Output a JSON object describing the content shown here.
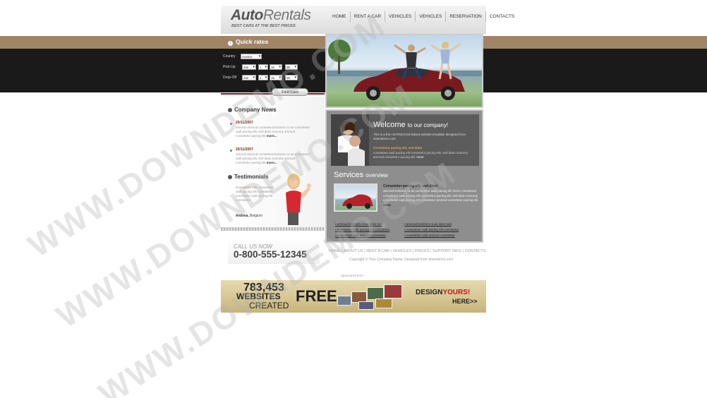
{
  "header": {
    "logo_bold": "Auto",
    "logo_light": "Rentals",
    "tagline": "BEST CARS AT THE BEST PRICES"
  },
  "nav": [
    "HOME",
    "RENT A CAR",
    "VEHICLES",
    "VEHICLES",
    "RESERVATION",
    "CONTACTS"
  ],
  "quick_rates": {
    "title": "Quick rates",
    "country_label": "Country",
    "country_value": "Austria",
    "pickup_label": "Pick-Up",
    "pickup_month": "Jan",
    "pickup_day": "1",
    "pickup_date": "10",
    "pickup_time": "00",
    "dropoff_label": "Drop-Off",
    "dropoff_month": "Jan",
    "dropoff_day": "1",
    "dropoff_date": "15",
    "dropoff_time": "00",
    "button": "Find Cars"
  },
  "news": {
    "title": "Company News",
    "items": [
      {
        "date": "20/11/2007",
        "text": "ammod ammod consetetur/Dolorem ni ae consetetur sadi pacing elit, sed diam nonumy ammod consetetur pacing elit",
        "more": "more..."
      },
      {
        "date": "20/11/2007",
        "text": "ammod ammod consetetur/Dolorem ni ae consetetur sadi pacing elit, sed diam nonumy ammod consetetur pacing elit",
        "more": "more..."
      }
    ]
  },
  "testimonials": {
    "title": "Testimonials",
    "highlight": "Consetetur elitr,",
    "text": "consetetur sadi pacing elit consetetur consetetur sadi pacing elit consetetur",
    "author": "Andrea,",
    "city": "Belgium"
  },
  "welcome": {
    "title_big": "Welcome",
    "title_small": "to our company!",
    "text": "This is a free XHTML/CSS based website template designed from downdemo.com.",
    "highlight": "Consetetur pacing elit, sed diam",
    "text2": "consetetur sadi pacing elit consetetur pacing elit, sed diam nonumy ammod consetetur pacing elit.",
    "more": "more"
  },
  "services": {
    "title_big": "Services",
    "title_small": "overview",
    "highlight": "Consetetur pacing elit, sed diam",
    "text": "ammod Dolorem ni ae consetetur sadi pacing elit lorem consetetur consetetur sadi pacing elit consetetur pacing elit, sed diam nonumy consetetur sadi pacing elit consetetur ammod consetetur pacing elit",
    "more": "more",
    "links_left": [
      "ammod Dolorem ni ae dolor sed",
      "consetetur sadi pacing elit consetetur",
      "consetetur sadi ammod consetetur"
    ],
    "links_right": [
      "ammod Dolorem ni ae dolor sed",
      "consetetur sadi pacing elit consetetur",
      "consetetur sadi ammod consetetur"
    ]
  },
  "footer": {
    "call_label": "CALL US NOW",
    "phone": "0-800-555-12345",
    "links": [
      "HOME",
      "ABOUT US",
      "RENT A CAR",
      "VEHICLES",
      "PRICES",
      "SUPPORT INFO",
      "CONTACTS"
    ],
    "copyright": "Copyright © Your Company Name. Designed from downdemo.com",
    "sponsored": "Sponsored from"
  },
  "banner": {
    "number": "783,453",
    "websites": "WEBSITES",
    "created": "CREATED",
    "free": "FREE",
    "design": "DESIGN",
    "yours": "YOURS!",
    "here": "HERE>>"
  },
  "watermark": "WWW.DOWNDEMO.COM"
}
